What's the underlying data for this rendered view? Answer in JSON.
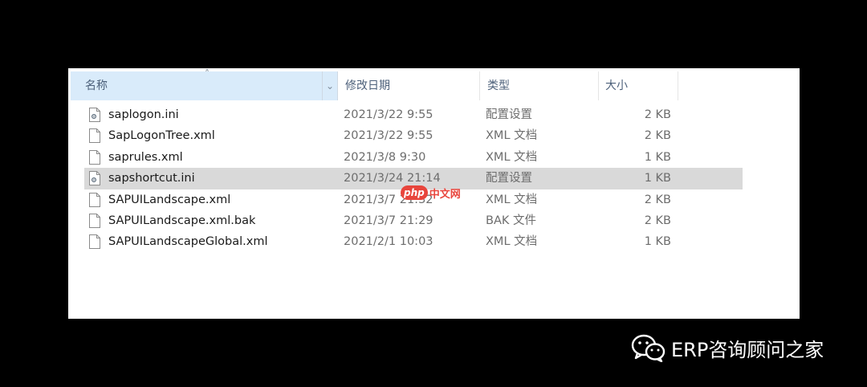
{
  "columns": {
    "name": "名称",
    "date": "修改日期",
    "type": "类型",
    "size": "大小"
  },
  "files": [
    {
      "name": "saplogon.ini",
      "date": "2021/3/22 9:55",
      "type": "配置设置",
      "size": "2 KB",
      "icon": "ini-settings-icon",
      "selected": false
    },
    {
      "name": "SapLogonTree.xml",
      "date": "2021/3/22 9:55",
      "type": "XML 文档",
      "size": "2 KB",
      "icon": "document-icon",
      "selected": false
    },
    {
      "name": "saprules.xml",
      "date": "2021/3/8 9:30",
      "type": "XML 文档",
      "size": "1 KB",
      "icon": "document-icon",
      "selected": false
    },
    {
      "name": "sapshortcut.ini",
      "date": "2021/3/24 21:14",
      "type": "配置设置",
      "size": "1 KB",
      "icon": "ini-settings-icon",
      "selected": true
    },
    {
      "name": "SAPUILandscape.xml",
      "date": "2021/3/7 21:32",
      "type": "XML 文档",
      "size": "2 KB",
      "icon": "document-icon",
      "selected": false
    },
    {
      "name": "SAPUILandscape.xml.bak",
      "date": "2021/3/7 21:29",
      "type": "BAK 文件",
      "size": "2 KB",
      "icon": "document-icon",
      "selected": false
    },
    {
      "name": "SAPUILandscapeGlobal.xml",
      "date": "2021/2/1 10:03",
      "type": "XML 文档",
      "size": "1 KB",
      "icon": "document-icon",
      "selected": false
    }
  ],
  "watermark": {
    "badge": "php",
    "text": "中文网"
  },
  "brand": {
    "text": "ERP咨询顾问之家",
    "icon": "wechat-icon"
  },
  "colors": {
    "header_selected": "#d9ebfa",
    "row_selected": "#d9d9d9",
    "watermark": "#e8453c"
  }
}
